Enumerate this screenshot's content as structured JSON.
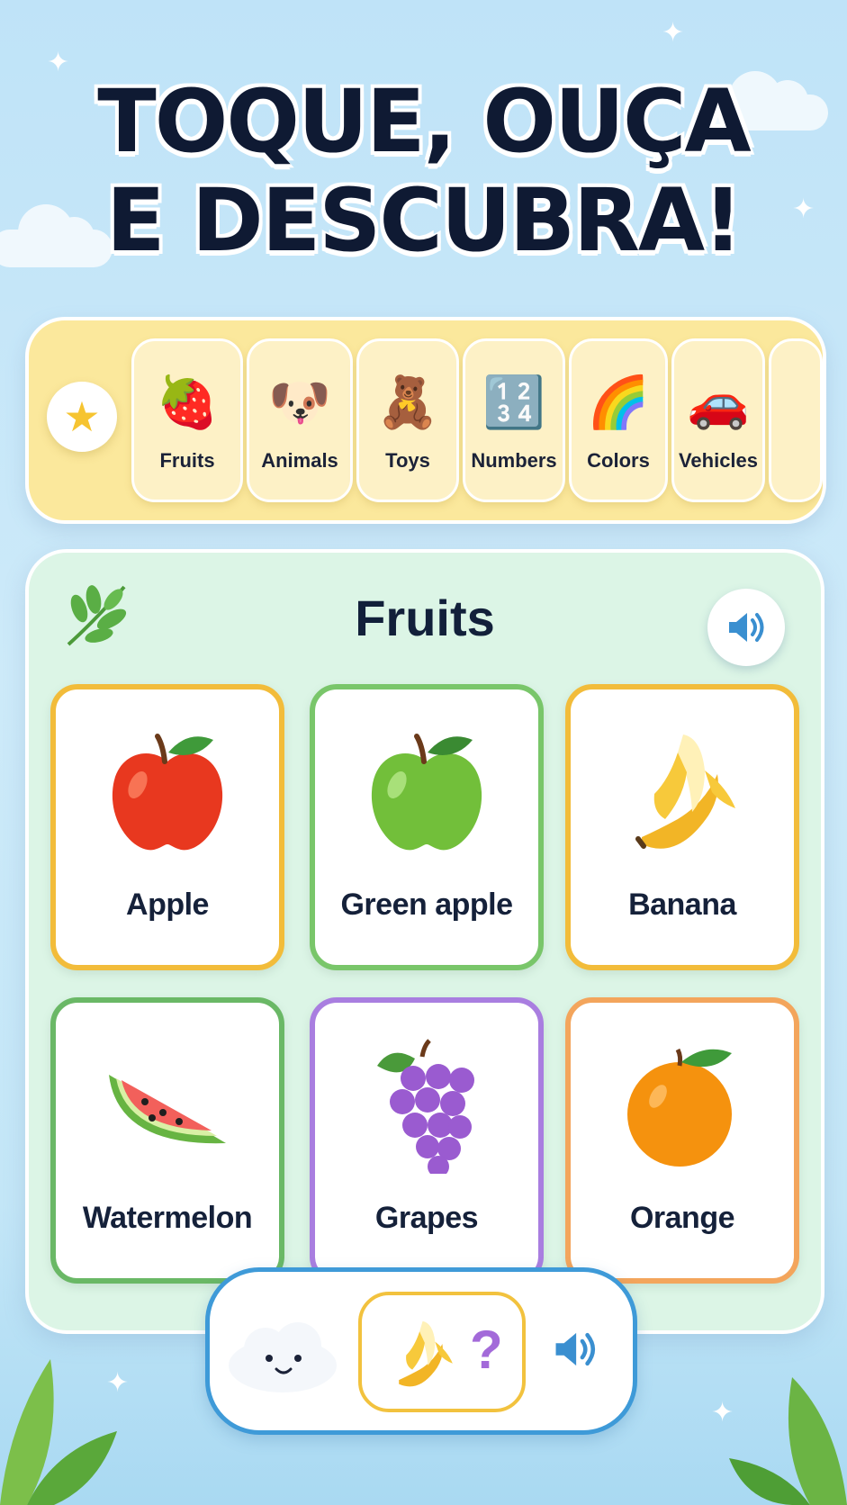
{
  "header": {
    "title_line1": "TOQUE, OUÇA",
    "title_line2": "E DESCUBRA!"
  },
  "categories": {
    "favorites_icon": "star-icon",
    "items": [
      {
        "label": "Fruits",
        "icon": "🍓"
      },
      {
        "label": "Animals",
        "icon": "🐶"
      },
      {
        "label": "Toys",
        "icon": "🧸"
      },
      {
        "label": "Numbers",
        "icon": "🔢"
      },
      {
        "label": "Colors",
        "icon": "🌈"
      },
      {
        "label": "Vehicles",
        "icon": "🚗"
      }
    ]
  },
  "panel": {
    "title": "Fruits",
    "sound_icon": "speaker-icon",
    "cards": [
      {
        "label": "Apple",
        "icon": "red-apple-icon",
        "border": "#f2bc3a"
      },
      {
        "label": "Green apple",
        "icon": "green-apple-icon",
        "border": "#79c66a"
      },
      {
        "label": "Banana",
        "icon": "banana-icon",
        "border": "#f2bc3a"
      },
      {
        "label": "Watermelon",
        "icon": "watermelon-icon",
        "border": "#6ab866"
      },
      {
        "label": "Grapes",
        "icon": "grapes-icon",
        "border": "#a97ee0"
      },
      {
        "label": "Orange",
        "icon": "orange-icon",
        "border": "#f3a55c"
      }
    ]
  },
  "quiz": {
    "prompt_icon": "banana-icon",
    "question_mark": "?",
    "sound_icon": "speaker-icon"
  },
  "colors": {
    "accent_blue": "#3e9ad8",
    "bar_yellow": "#fbe89c",
    "panel_green": "#dcf5e6",
    "title_text": "#0f1a33"
  }
}
